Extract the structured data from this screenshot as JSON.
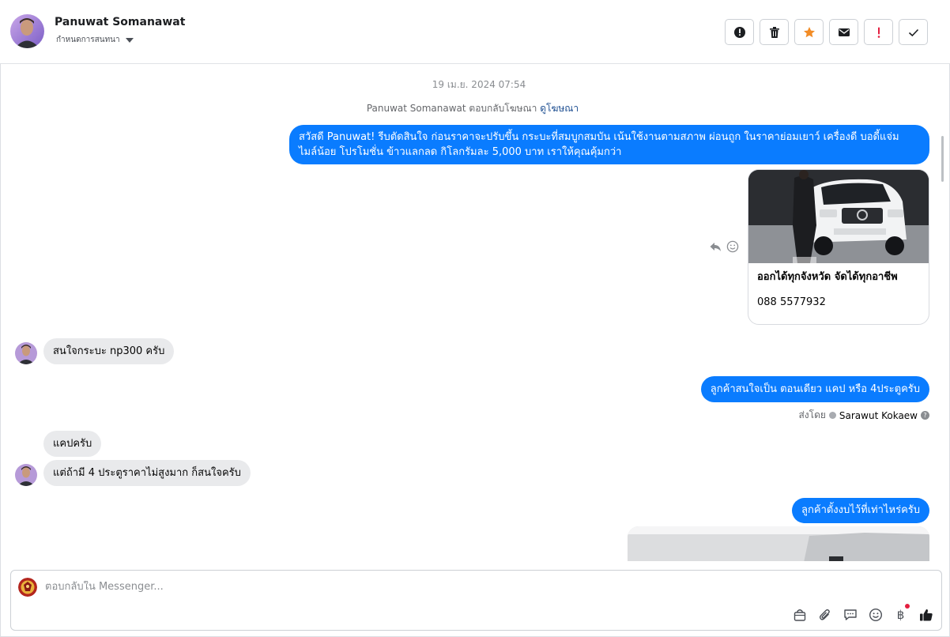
{
  "header": {
    "contact_name": "Panuwat Somanawat",
    "stage_label": "กำหนดการสนทนา",
    "buttons": [
      {
        "icon": "alert-circle-icon"
      },
      {
        "icon": "trash-icon"
      },
      {
        "icon": "star-icon",
        "color": "#f28c26"
      },
      {
        "icon": "envelope-icon"
      },
      {
        "icon": "exclamation-icon",
        "color": "#e41e3f"
      },
      {
        "icon": "check-icon"
      }
    ]
  },
  "thread": {
    "date": "19 เม.ย. 2024 07:54",
    "reply_note": "Panuwat Somanawat ตอบกลับโฆษณา",
    "reply_link": "ดูโฆษณา",
    "messages": {
      "out_1": "สวัสดี Panuwat! รีบตัดสินใจ ก่อนราคาจะปรับขึ้น กระบะที่สมบูกสมบัน เน้นใช้งานตามสภาพ ผ่อนถูก ในราคาย่อมเยาว์ เครื่องดี บอดี้แจ่ม ไมล์น้อย โปรโมชั่น ข้าวแลกลด กิโลกรัมละ 5,000 บาท เราให้คุณคุ้มกว่า",
      "ad_title": "ออกได้ทุกจังหวัด จัดได้ทุกอาชีพ",
      "ad_phone": "088 5577932",
      "in_1": "สนใจกระบะ np300 ครับ",
      "out_2": "ลูกค้าสนใจเป็น ตอนเดียว แคป หรือ 4ประตูครับ",
      "sent_by_label": "ส่งโดย",
      "sent_by_name": "Sarawut Kokaew",
      "in_2": "แคปครับ",
      "in_3": "แต่ถ้ามี 4 ประตูราคาไม่สูงมาก ก็สนใจครับ",
      "out_3": "ลูกค้าตั้งงบไว้ที่เท่าไหร่ครับ"
    }
  },
  "composer": {
    "placeholder": "ตอบกลับใน Messenger...",
    "tools": [
      "bag-icon",
      "paperclip-icon",
      "saved-replies-icon",
      "emoji-icon",
      "baht-icon",
      "thumbs-up-icon"
    ],
    "baht_symbol": "฿"
  },
  "colors": {
    "outgoing_bubble": "#0a7cff",
    "incoming_bubble": "#e9eaec",
    "link": "#1d4e91"
  }
}
